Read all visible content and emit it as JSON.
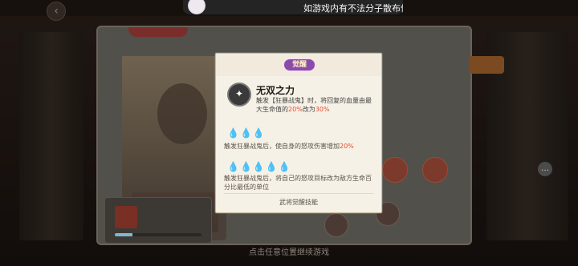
{
  "marquee": {
    "text": "如游戏内有不法分子散布信"
  },
  "modal": {
    "badge": "觉醒",
    "skill_title": "无双之力",
    "desc": {
      "before": "触发【狂暴战鬼】时，将回复的血量由最大生命值的",
      "a": "20%",
      "mid": "改为",
      "b": "30%"
    },
    "tier1": {
      "flames": "💧💧💧",
      "text_before": "触发狂暴战鬼后，使自身的怒攻伤害增加",
      "value": "20%"
    },
    "tier2": {
      "flames": "💧💧💧💧💧",
      "text": "触发狂暴战鬼后，将自己的怒攻目标改为敌方生命百分比最低的单位"
    },
    "footer": "武将觉醒技能"
  },
  "hint": "点击任意位置继续游戏",
  "chat_icon": "chat-bubble-icon"
}
